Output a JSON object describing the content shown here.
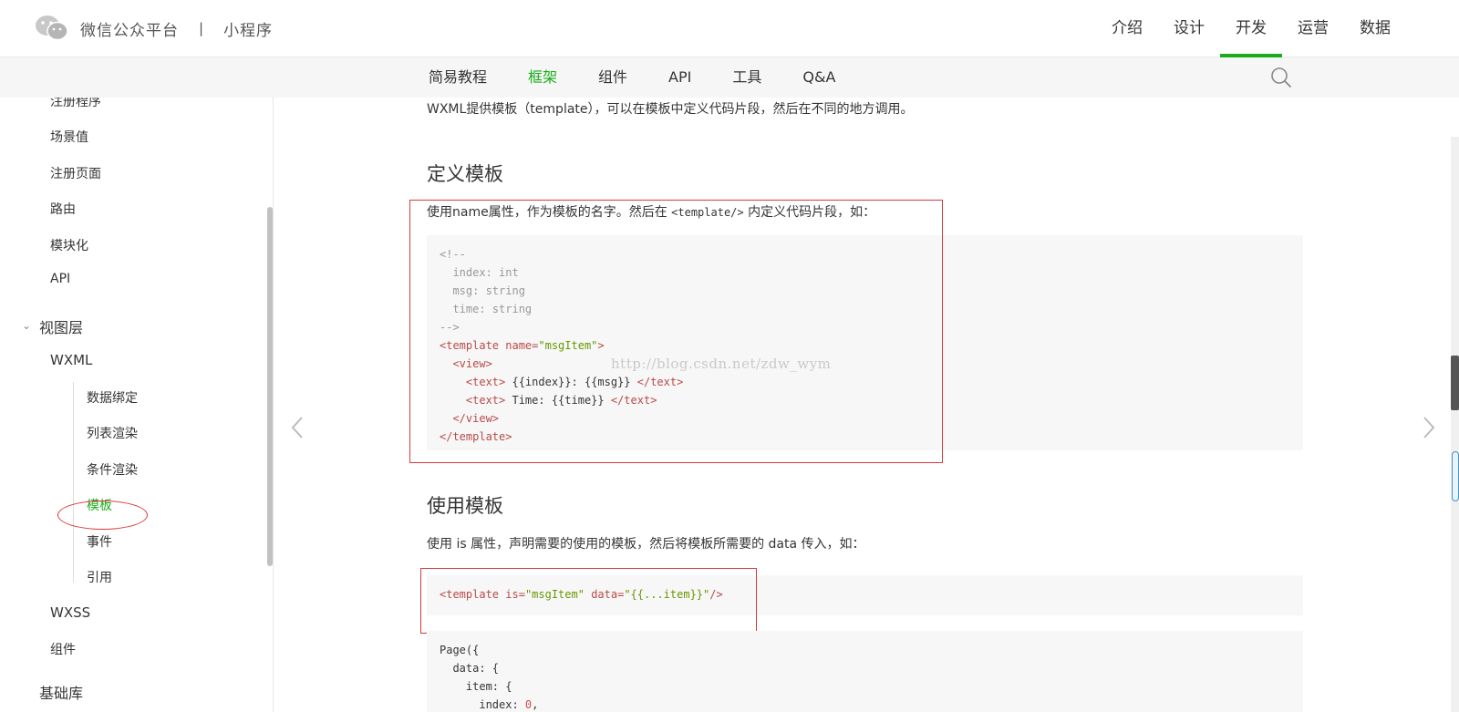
{
  "header": {
    "brand": "微信公众平台",
    "separator": "|",
    "product": "小程序",
    "nav": [
      "介绍",
      "设计",
      "开发",
      "运营",
      "数据"
    ],
    "active_nav_index": 2
  },
  "subnav": {
    "items": [
      "简易教程",
      "框架",
      "组件",
      "API",
      "工具",
      "Q&A"
    ],
    "active_index": 1
  },
  "sidebar": {
    "items": {
      "register_app": "注册程序",
      "scene": "场景值",
      "register_page": "注册页面",
      "route": "路由",
      "module": "模块化",
      "api": "API",
      "view_layer": "视图层",
      "wxml": "WXML",
      "data_binding": "数据绑定",
      "list_render": "列表渲染",
      "cond_render": "条件渲染",
      "template": "模板",
      "event": "事件",
      "reference": "引用",
      "wxss": "WXSS",
      "component": "组件",
      "base_lib": "基础库"
    }
  },
  "content": {
    "intro": "WXML提供模板（template），可以在模板中定义代码片段，然后在不同的地方调用。",
    "define_title": "定义模板",
    "define_desc_pre": "使用name属性，作为模板的名字。然后在",
    "define_desc_code": "<template/>",
    "define_desc_post": "内定义代码片段，如：",
    "code1": {
      "c1": "<!--",
      "c2": "  index: int",
      "c3": "  msg: string",
      "c4": "  time: string",
      "c5": "-->",
      "t1_open": "<template ",
      "t1_attr": "name=",
      "t1_val": "\"msgItem\"",
      "t1_close": ">",
      "view_open": "  <view>",
      "text1_open": "    <text>",
      "text1_body": " {{index}}: {{msg}} ",
      "text1_close": "</text>",
      "text2_open": "    <text>",
      "text2_body": " Time: {{time}} ",
      "text2_close": "</text>",
      "view_close": "  </view>",
      "t_end": "</template>"
    },
    "use_title": "使用模板",
    "use_desc": "使用 is 属性，声明需要的使用的模板，然后将模板所需要的 data 传入，如：",
    "code2": {
      "open": "<template ",
      "is_attr": "is=",
      "is_val": "\"msgItem\"",
      "data_attr": " data=",
      "data_val": "\"{{...item}}\"",
      "close": "/>"
    },
    "code3": {
      "l1": "Page({",
      "l2": "  data: {",
      "l3": "    item: {",
      "l4_key": "      index: ",
      "l4_val": "0",
      "l4_end": ","
    },
    "watermark": "http://blog.csdn.net/zdw_wym"
  },
  "colors": {
    "accent": "#1aad19",
    "annotation": "#d9383a"
  }
}
